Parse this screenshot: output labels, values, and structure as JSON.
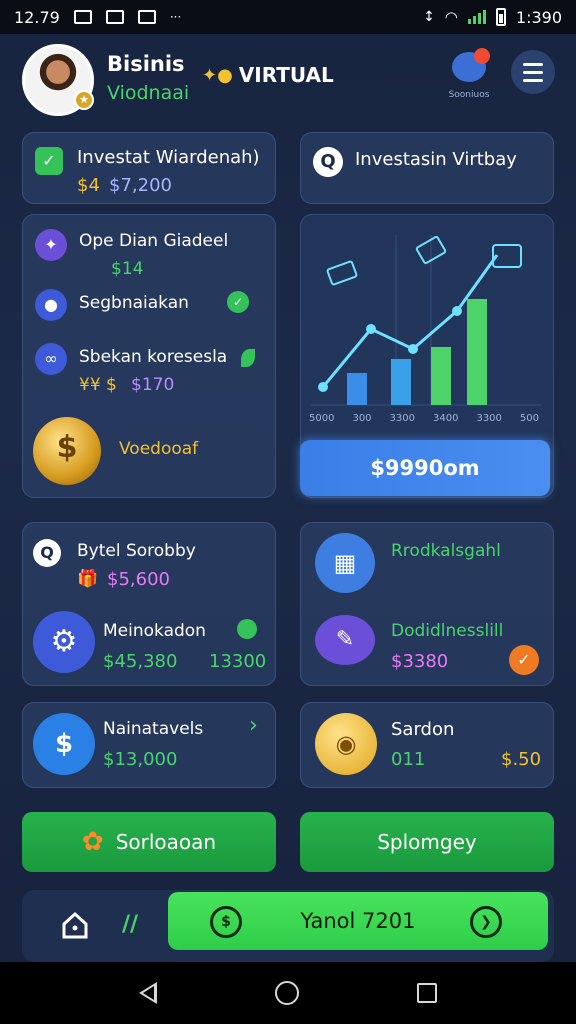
{
  "status_bar": {
    "time": "12.79",
    "right_time": "1:390"
  },
  "header": {
    "title": "Bisinis",
    "subtitle": "Viodnaai",
    "virtual_label": "VIRTUAL",
    "notification_label": "Sooniuos"
  },
  "cards": {
    "invest_left": {
      "title": "Investat Wiardenah)",
      "amount_prefix": "$4",
      "amount": "$7,200"
    },
    "invest_right": {
      "title": "Investasin Virtbay"
    },
    "list": {
      "item1_title": "Ope Dian Giadeel",
      "item1_value": "$14",
      "item2_title": "Segbnaiakan",
      "item3_title": "Sbekan koresesla",
      "item3_prefix": "¥¥ $",
      "item3_value": "$170",
      "coin_label": "Voedooaf"
    },
    "chart_panel": {
      "x_ticks": [
        "5000",
        "300",
        "3300",
        "3400",
        "3300",
        "500"
      ],
      "cta_label": "$9990om"
    },
    "bytet": {
      "title": "Bytel Sorobby",
      "amount": "$5,600",
      "sub_title": "Meinokadon",
      "sub_amount": "$45,380",
      "sub_value": "13300"
    },
    "rroduct": {
      "title": "Rrodkalsgahl",
      "sub_title": "Dodidlnesslill",
      "sub_amount": "$3380"
    },
    "naina": {
      "title": "Nainatavels",
      "amount": "$13,000"
    },
    "saron": {
      "title": "Sardon",
      "value": "011",
      "amount": "$.50"
    }
  },
  "buttons": {
    "left_green": "Sorloaoan",
    "right_green": "Splomgey",
    "big_green": "Yanol 7201"
  },
  "colors": {
    "background": "#18243f",
    "card": "#283a60",
    "accent_green": "#49d46b",
    "accent_gold": "#f2c230",
    "accent_blue": "#3a7ee8"
  },
  "icons": [
    "check-icon",
    "search-icon",
    "star-icon",
    "user-icon",
    "link-icon",
    "coin-stack-icon",
    "chart-icon",
    "gift-icon",
    "box-icon",
    "gear-icon",
    "pen-icon",
    "dollar-icon",
    "lightbulb-icon",
    "home-icon",
    "arrow-icon"
  ]
}
